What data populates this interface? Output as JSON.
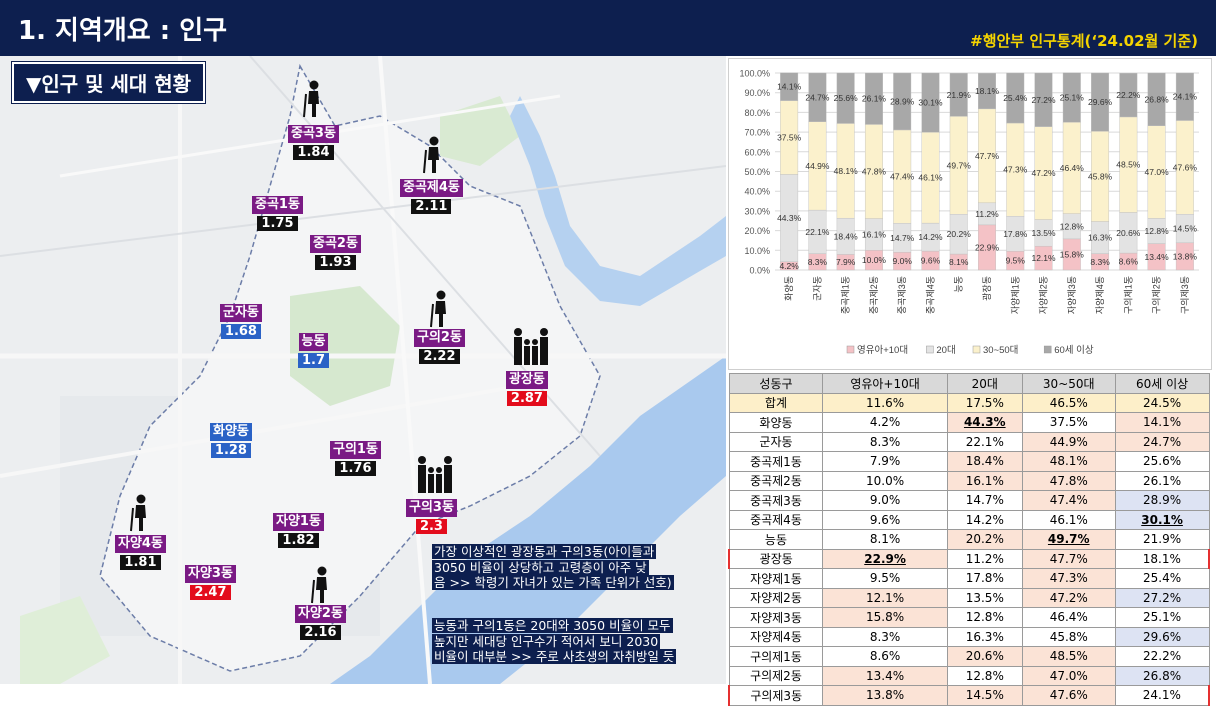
{
  "header": {
    "title": "1. 지역개요 : 인구",
    "source": "#행안부 인구통계(‘24.02월 기준)",
    "section": "▼인구 및 세대 현황"
  },
  "map": {
    "dongs": [
      {
        "name": "중곡3동",
        "value": "1.84"
      },
      {
        "name": "중곡제4동",
        "value": "2.11"
      },
      {
        "name": "중곡1동",
        "value": "1.75"
      },
      {
        "name": "중곡2동",
        "value": "1.93"
      },
      {
        "name": "군자동",
        "value": "1.68"
      },
      {
        "name": "능동",
        "value": "1.7"
      },
      {
        "name": "구의2동",
        "value": "2.22"
      },
      {
        "name": "광장동",
        "value": "2.87"
      },
      {
        "name": "화양동",
        "value": "1.28"
      },
      {
        "name": "구의1동",
        "value": "1.76"
      },
      {
        "name": "구의3동",
        "value": "2.3"
      },
      {
        "name": "자양1동",
        "value": "1.82"
      },
      {
        "name": "자양4동",
        "value": "1.81"
      },
      {
        "name": "자양3동",
        "value": "2.47"
      },
      {
        "name": "자양2동",
        "value": "2.16"
      }
    ],
    "notes": [
      [
        "가장 이상적인 광장동과 구의3동(아이들과",
        "3050 비율이 상당하고 고령층이 아주 낮",
        "음 >> 학령기 자녀가 있는 가족 단위가 선호)"
      ],
      [
        "능동과 구의1동은 20대와 3050 비율이 모두",
        "높지만 세대당 인구수가 적어서 보니 2030",
        "비율이 대부분 >> 주로 사초생의 자취방일 듯"
      ]
    ]
  },
  "chart_data": {
    "type": "bar",
    "stacked": true,
    "percent": true,
    "categories": [
      "화양동",
      "군자동",
      "중곡제1동",
      "중곡제2동",
      "중곡제3동",
      "중곡제4동",
      "능동",
      "광장동",
      "자양제1동",
      "자양제2동",
      "자양제3동",
      "자양제4동",
      "구의제1동",
      "구의제2동",
      "구의제3동"
    ],
    "series": [
      {
        "name": "영유아+10대",
        "color": "#f4c2c6",
        "values": [
          4.2,
          8.3,
          7.9,
          10.0,
          9.0,
          9.6,
          8.1,
          22.9,
          9.5,
          12.1,
          15.8,
          8.3,
          8.6,
          13.4,
          13.8
        ]
      },
      {
        "name": "20대",
        "color": "#e3e3e3",
        "values": [
          44.3,
          22.1,
          18.4,
          16.1,
          14.7,
          14.2,
          20.2,
          11.2,
          17.8,
          13.5,
          12.8,
          16.3,
          20.6,
          12.8,
          14.5
        ]
      },
      {
        "name": "30~50대",
        "color": "#fbf1cc",
        "values": [
          37.5,
          44.9,
          48.1,
          47.8,
          47.4,
          46.1,
          49.7,
          47.7,
          47.3,
          47.2,
          46.4,
          45.8,
          48.5,
          47.0,
          47.6
        ]
      },
      {
        "name": "60세 이상",
        "color": "#a8a8a8",
        "values": [
          14.1,
          24.7,
          25.6,
          26.1,
          28.9,
          30.1,
          21.9,
          18.1,
          25.4,
          27.2,
          25.1,
          29.6,
          22.2,
          26.8,
          24.1
        ]
      }
    ],
    "yticks": [
      "0.0%",
      "10.0%",
      "20.0%",
      "30.0%",
      "40.0%",
      "50.0%",
      "60.0%",
      "70.0%",
      "80.0%",
      "90.0%",
      "100.0%"
    ],
    "ylim": [
      0,
      100
    ],
    "legend": "bottom"
  },
  "table": {
    "headers": [
      "성동구",
      "영유아+10대",
      "20대",
      "30~50대",
      "60세 이상"
    ],
    "rows": [
      [
        "합계",
        "11.6%",
        "17.5%",
        "46.5%",
        "24.5%"
      ],
      [
        "화양동",
        "4.2%",
        "44.3%",
        "37.5%",
        "14.1%"
      ],
      [
        "군자동",
        "8.3%",
        "22.1%",
        "44.9%",
        "24.7%"
      ],
      [
        "중곡제1동",
        "7.9%",
        "18.4%",
        "48.1%",
        "25.6%"
      ],
      [
        "중곡제2동",
        "10.0%",
        "16.1%",
        "47.8%",
        "26.1%"
      ],
      [
        "중곡제3동",
        "9.0%",
        "14.7%",
        "47.4%",
        "28.9%"
      ],
      [
        "중곡제4동",
        "9.6%",
        "14.2%",
        "46.1%",
        "30.1%"
      ],
      [
        "능동",
        "8.1%",
        "20.2%",
        "49.7%",
        "21.9%"
      ],
      [
        "광장동",
        "22.9%",
        "11.2%",
        "47.7%",
        "18.1%"
      ],
      [
        "자양제1동",
        "9.5%",
        "17.8%",
        "47.3%",
        "25.4%"
      ],
      [
        "자양제2동",
        "12.1%",
        "13.5%",
        "47.2%",
        "27.2%"
      ],
      [
        "자양제3동",
        "15.8%",
        "12.8%",
        "46.4%",
        "25.1%"
      ],
      [
        "자양제4동",
        "8.3%",
        "16.3%",
        "45.8%",
        "29.6%"
      ],
      [
        "구의제1동",
        "8.6%",
        "20.6%",
        "48.5%",
        "22.2%"
      ],
      [
        "구의제2동",
        "13.4%",
        "12.8%",
        "47.0%",
        "26.8%"
      ],
      [
        "구의제3동",
        "13.8%",
        "14.5%",
        "47.6%",
        "24.1%"
      ]
    ]
  }
}
